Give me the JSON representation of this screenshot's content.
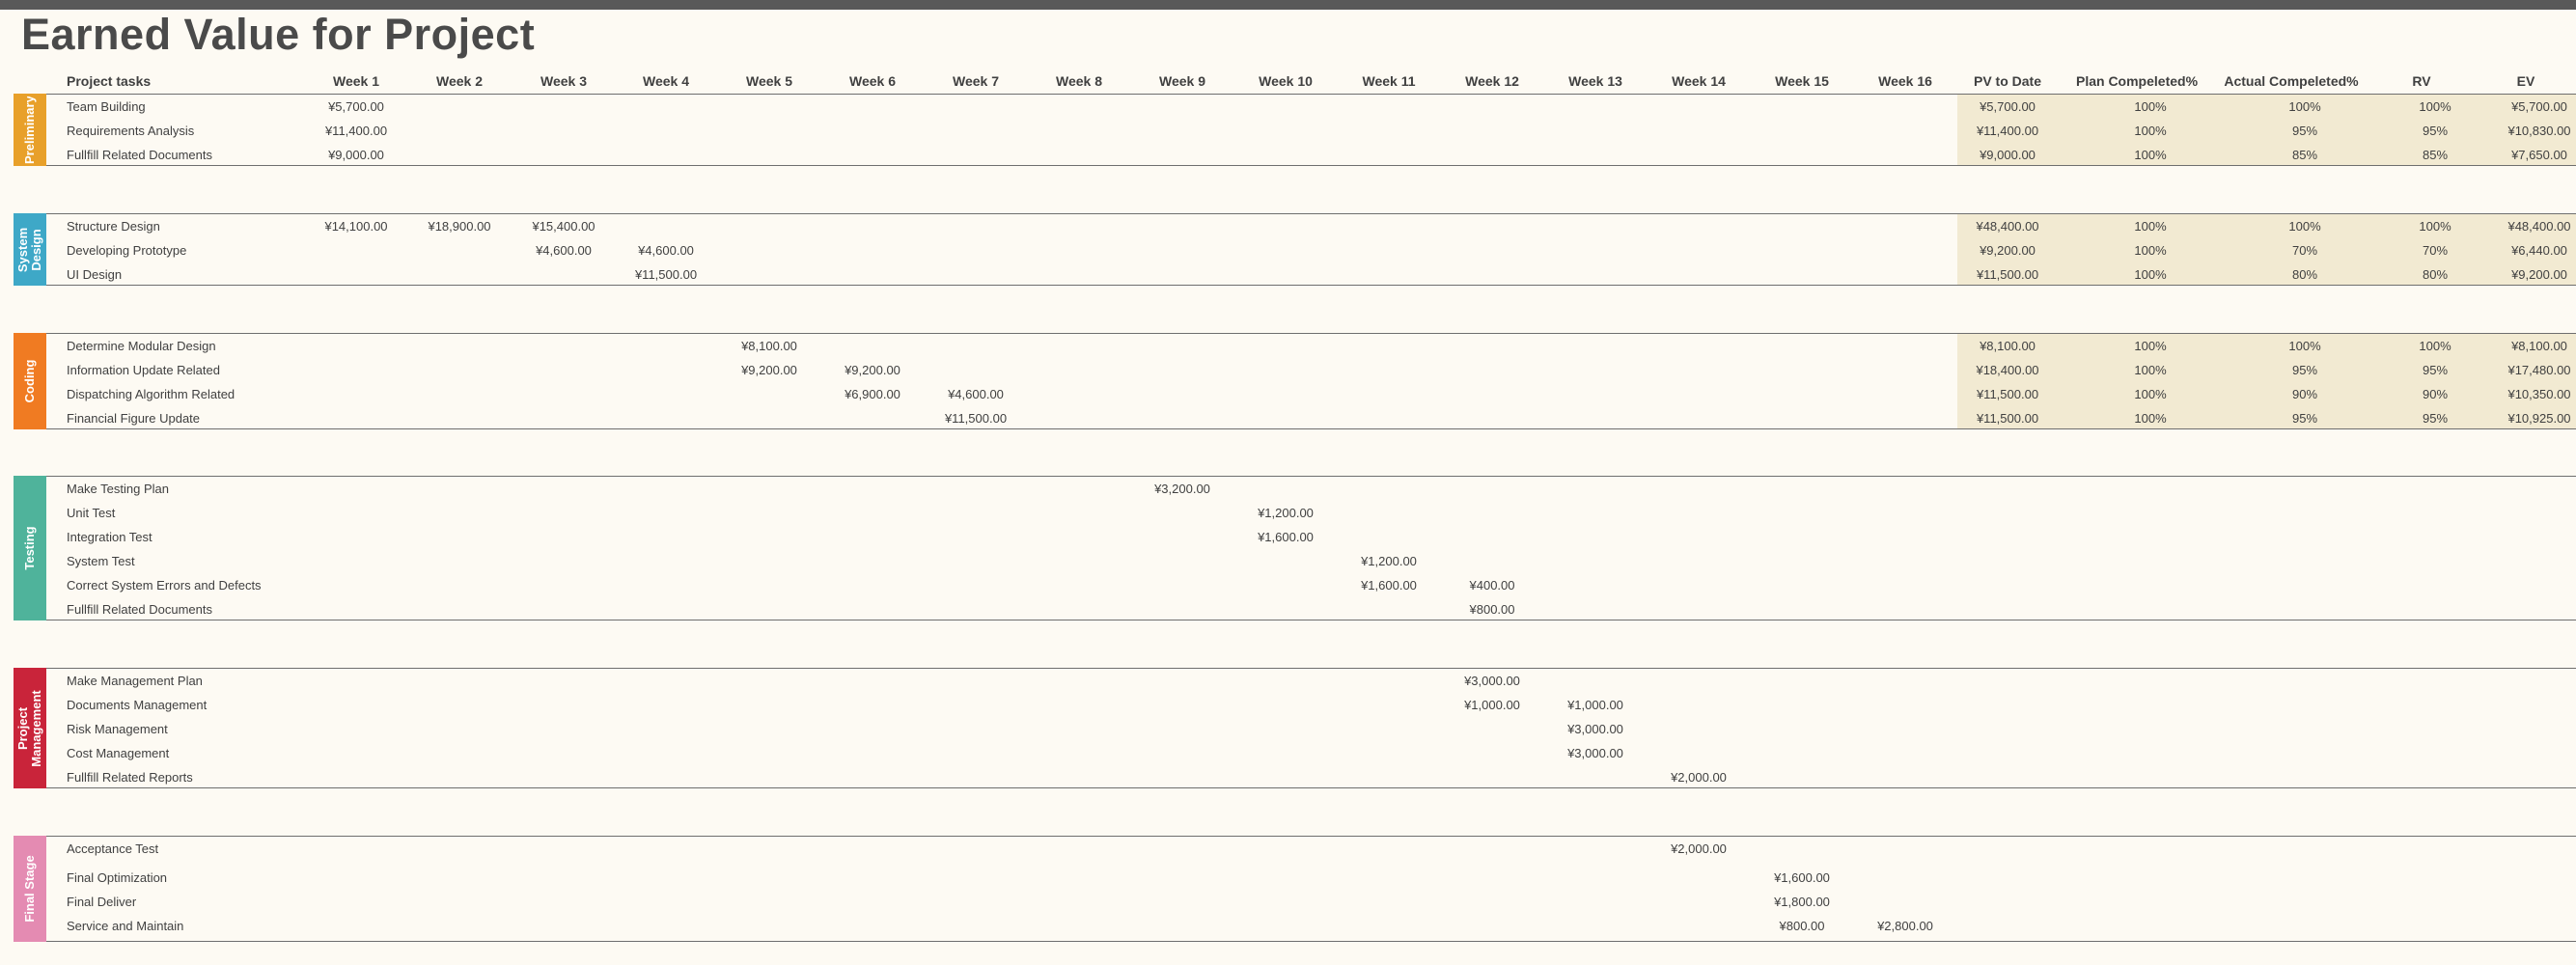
{
  "title": "Earned Value for Project",
  "headers": {
    "task": "Project tasks",
    "weeks": [
      "Week 1",
      "Week 2",
      "Week 3",
      "Week 4",
      "Week 5",
      "Week 6",
      "Week 7",
      "Week 8",
      "Week 9",
      "Week 10",
      "Week 11",
      "Week 12",
      "Week 13",
      "Week 14",
      "Week 15",
      "Week 16"
    ],
    "pv_to_date": "PV to Date",
    "plan_completed": "Plan Compeleted%",
    "actual_completed": "Actual Compeleted%",
    "rv": "RV",
    "ev": "EV"
  },
  "colors": {
    "preliminary": "#e8a02a",
    "system_design": "#3ea8c7",
    "coding": "#f07b22",
    "testing": "#4fb39b",
    "project_management": "#c9243a",
    "final_stage": "#e48bb2",
    "summary_bg": "#f2ead2"
  },
  "groups": [
    {
      "label": "Preliminary",
      "color": "#e8a02a",
      "has_summary": true,
      "rows": [
        {
          "task": "Team Building",
          "weeks": {
            "1": "¥5,700.00"
          },
          "pv": "¥5,700.00",
          "plan": "100%",
          "actual": "100%",
          "rv": "100%",
          "ev": "¥5,700.00"
        },
        {
          "task": "Requirements Analysis",
          "weeks": {
            "1": "¥11,400.00"
          },
          "pv": "¥11,400.00",
          "plan": "100%",
          "actual": "95%",
          "rv": "95%",
          "ev": "¥10,830.00"
        },
        {
          "task": "Fullfill Related Documents",
          "weeks": {
            "1": "¥9,000.00"
          },
          "pv": "¥9,000.00",
          "plan": "100%",
          "actual": "85%",
          "rv": "85%",
          "ev": "¥7,650.00"
        }
      ]
    },
    {
      "label": "System Design",
      "color": "#3ea8c7",
      "has_summary": true,
      "rows": [
        {
          "task": "Structure Design",
          "weeks": {
            "1": "¥14,100.00",
            "2": "¥18,900.00",
            "3": "¥15,400.00"
          },
          "pv": "¥48,400.00",
          "plan": "100%",
          "actual": "100%",
          "rv": "100%",
          "ev": "¥48,400.00"
        },
        {
          "task": "Developing Prototype",
          "weeks": {
            "3": "¥4,600.00",
            "4": "¥4,600.00"
          },
          "pv": "¥9,200.00",
          "plan": "100%",
          "actual": "70%",
          "rv": "70%",
          "ev": "¥6,440.00"
        },
        {
          "task": "UI Design",
          "weeks": {
            "4": "¥11,500.00"
          },
          "pv": "¥11,500.00",
          "plan": "100%",
          "actual": "80%",
          "rv": "80%",
          "ev": "¥9,200.00"
        }
      ]
    },
    {
      "label": "Coding",
      "color": "#f07b22",
      "has_summary": true,
      "rows": [
        {
          "task": "Determine Modular Design",
          "weeks": {
            "5": "¥8,100.00"
          },
          "pv": "¥8,100.00",
          "plan": "100%",
          "actual": "100%",
          "rv": "100%",
          "ev": "¥8,100.00"
        },
        {
          "task": "Information Update Related",
          "weeks": {
            "5": "¥9,200.00",
            "6": "¥9,200.00"
          },
          "pv": "¥18,400.00",
          "plan": "100%",
          "actual": "95%",
          "rv": "95%",
          "ev": "¥17,480.00"
        },
        {
          "task": "Dispatching Algorithm Related",
          "weeks": {
            "6": "¥6,900.00",
            "7": "¥4,600.00"
          },
          "pv": "¥11,500.00",
          "plan": "100%",
          "actual": "90%",
          "rv": "90%",
          "ev": "¥10,350.00"
        },
        {
          "task": "Financial Figure Update",
          "weeks": {
            "7": "¥11,500.00"
          },
          "pv": "¥11,500.00",
          "plan": "100%",
          "actual": "95%",
          "rv": "95%",
          "ev": "¥10,925.00"
        }
      ]
    },
    {
      "label": "Testing",
      "color": "#4fb39b",
      "has_summary": false,
      "rows": [
        {
          "task": "Make Testing Plan",
          "weeks": {
            "9": "¥3,200.00"
          }
        },
        {
          "task": "Unit Test",
          "weeks": {
            "10": "¥1,200.00"
          }
        },
        {
          "task": "Integration Test",
          "weeks": {
            "10": "¥1,600.00"
          }
        },
        {
          "task": "System Test",
          "weeks": {
            "11": "¥1,200.00"
          }
        },
        {
          "task": "Correct System Errors and Defects",
          "weeks": {
            "11": "¥1,600.00",
            "12": "¥400.00"
          }
        },
        {
          "task": "Fullfill Related Documents",
          "weeks": {
            "12": "¥800.00"
          }
        }
      ]
    },
    {
      "label": "Project Management",
      "color": "#c9243a",
      "has_summary": false,
      "rows": [
        {
          "task": "Make Management Plan",
          "weeks": {
            "12": "¥3,000.00"
          }
        },
        {
          "task": "Documents Management",
          "weeks": {
            "12": "¥1,000.00",
            "13": "¥1,000.00"
          }
        },
        {
          "task": "Risk Management",
          "weeks": {
            "13": "¥3,000.00"
          }
        },
        {
          "task": "Cost Management",
          "weeks": {
            "13": "¥3,000.00"
          }
        },
        {
          "task": "Fullfill Related Reports",
          "weeks": {
            "14": "¥2,000.00"
          }
        }
      ]
    },
    {
      "label": "Final Stage",
      "color": "#e48bb2",
      "has_summary": false,
      "rows": [
        {
          "task": "Acceptance Test",
          "weeks": {
            "14": "¥2,000.00"
          }
        },
        {
          "task": "Final Optimization",
          "weeks": {
            "15": "¥1,600.00"
          }
        },
        {
          "task": "Final Deliver",
          "weeks": {
            "15": "¥1,800.00"
          }
        },
        {
          "task": "Service and Maintain",
          "weeks": {
            "15": "¥800.00",
            "16": "¥2,800.00"
          }
        }
      ]
    }
  ]
}
